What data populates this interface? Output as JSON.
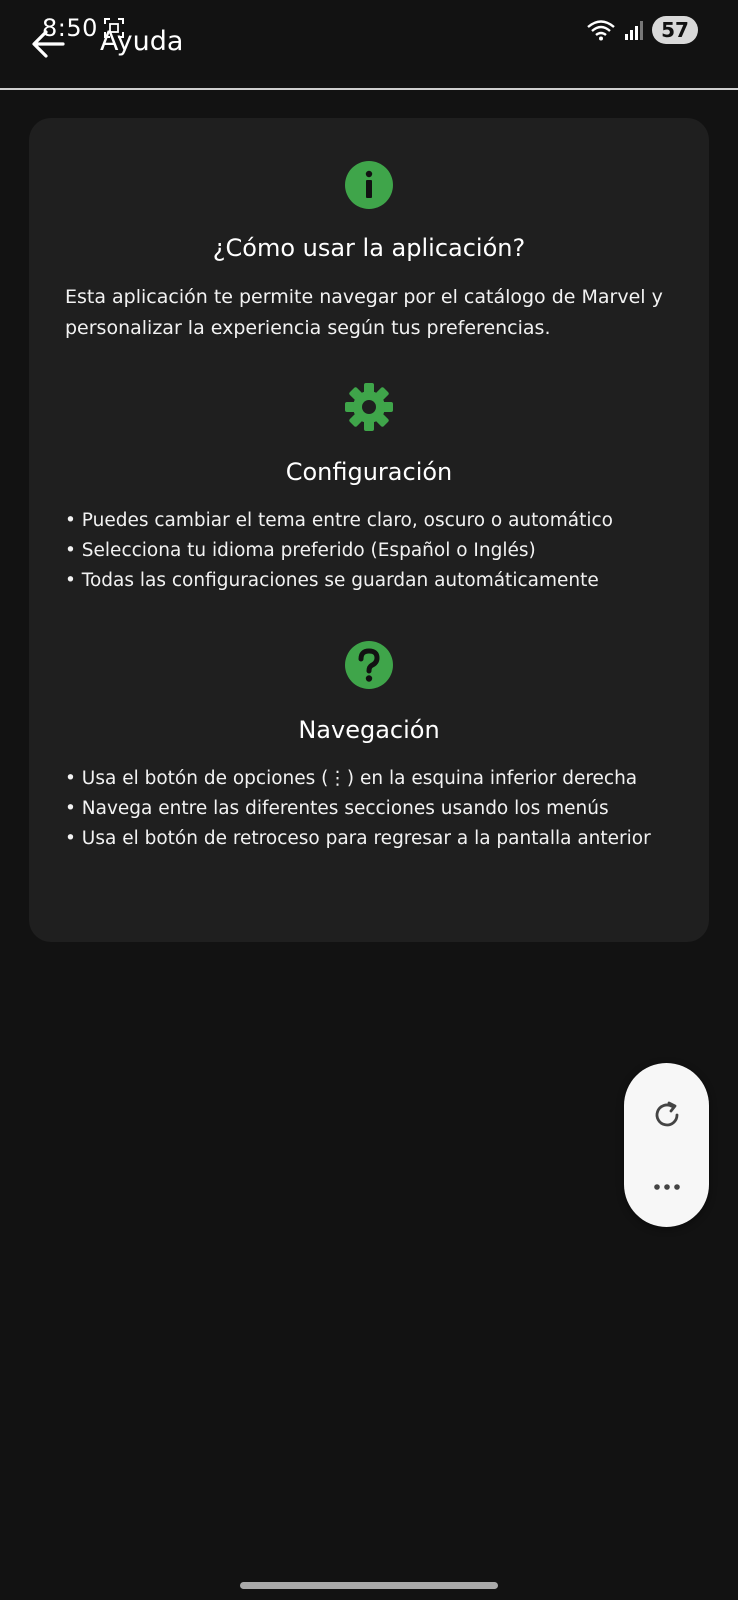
{
  "status_bar": {
    "time": "8:50",
    "battery": "57"
  },
  "app_bar": {
    "title": "Ayuda"
  },
  "sections": {
    "usage": {
      "icon": "info-icon",
      "title": "¿Cómo usar la aplicación?",
      "body": "Esta aplicación te permite navegar por el catálogo de Marvel y personalizar la experiencia según tus preferencias."
    },
    "settings": {
      "icon": "gear-icon",
      "title": "Configuración",
      "items": [
        "• Puedes cambiar el tema entre claro, oscuro o automático",
        "• Selecciona tu idioma preferido (Español o Inglés)",
        "• Todas las configuraciones se guardan automáticamente"
      ]
    },
    "navigation": {
      "icon": "question-icon",
      "title": "Navegación",
      "items": [
        "• Usa el botón de opciones (⋮) en la esquina inferior derecha",
        "• Navega entre las diferentes secciones usando los menús",
        "• Usa el botón de retroceso para regresar a la pantalla anterior"
      ]
    }
  },
  "floating_menu": {
    "refresh_icon": "refresh-icon",
    "more_icon": "more-horizontal-icon"
  },
  "colors": {
    "accent": "#3fa54a",
    "background": "#121212",
    "card": "#1f1f1f"
  }
}
